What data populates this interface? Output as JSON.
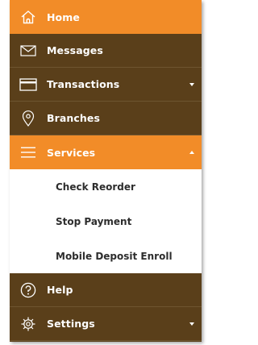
{
  "colors": {
    "accent": "#f28c28",
    "menu_bg": "#5a3f1a",
    "divider": "#6e5530",
    "submenu_bg": "#ffffff",
    "submenu_text": "#2d2d2d"
  },
  "menu": {
    "home": {
      "label": "Home",
      "icon": "home-icon"
    },
    "messages": {
      "label": "Messages",
      "icon": "envelope-icon"
    },
    "transactions": {
      "label": "Transactions",
      "icon": "card-icon"
    },
    "branches": {
      "label": "Branches",
      "icon": "location-pin-icon"
    },
    "services": {
      "label": "Services",
      "icon": "hamburger-icon"
    },
    "services_sub": [
      "Check Reorder",
      "Stop Payment",
      "Mobile Deposit Enroll"
    ],
    "help": {
      "label": "Help",
      "icon": "question-icon"
    },
    "settings": {
      "label": "Settings",
      "icon": "gear-icon"
    }
  }
}
